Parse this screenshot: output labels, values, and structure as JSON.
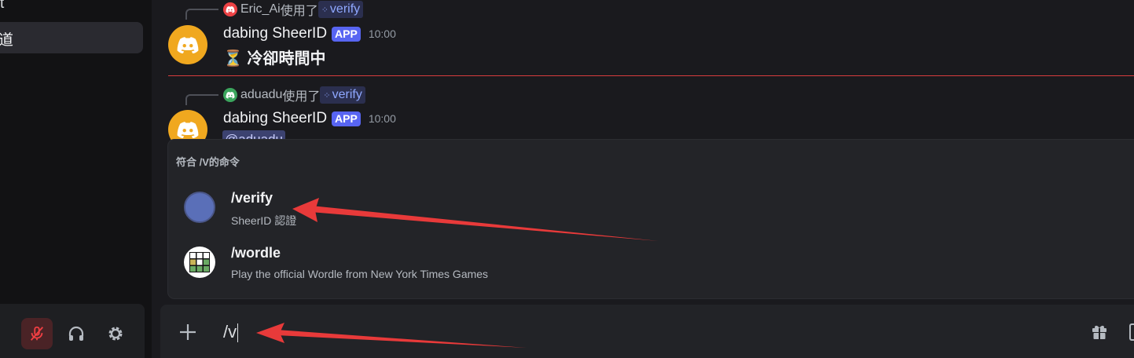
{
  "sidebar": {
    "top_fragment": "t",
    "selected_channel": "道",
    "user_controls": {
      "mute_icon": "mic-muted-icon",
      "deafen_icon": "headphones-icon",
      "settings_icon": "gear-icon"
    }
  },
  "messages": [
    {
      "reply": {
        "user": "Eric_Ai",
        "used_text": "使用了",
        "command": "verify",
        "avatar_color": "#ed4245"
      },
      "author": "dabing SheerID",
      "tag": "APP",
      "time": "10:00",
      "icon": "hourglass-icon",
      "body": "冷卻時間中"
    },
    {
      "reply": {
        "user": "aduadu",
        "used_text": "使用了",
        "command": "verify",
        "avatar_color": "#3ba55d"
      },
      "author": "dabing SheerID",
      "tag": "APP",
      "time": "10:00",
      "mention": "@aduadu"
    }
  ],
  "autocomplete": {
    "title": "符合 /V的命令",
    "items": [
      {
        "name": "/verify",
        "description": "SheerID 認證",
        "icon": "verify-app-icon",
        "icon_color": "#5a6fb8"
      },
      {
        "name": "/wordle",
        "description": "Play the official Wordle from New York Times Games",
        "icon": "wordle-grid-icon"
      }
    ]
  },
  "input": {
    "value": "/v",
    "add_icon": "plus-icon",
    "gift_icon": "gift-icon"
  },
  "colors": {
    "accent": "#5865f2",
    "arrow": "#e83a3a",
    "new_divider": "#d83c3e",
    "bot_avatar": "#f0a81f"
  }
}
